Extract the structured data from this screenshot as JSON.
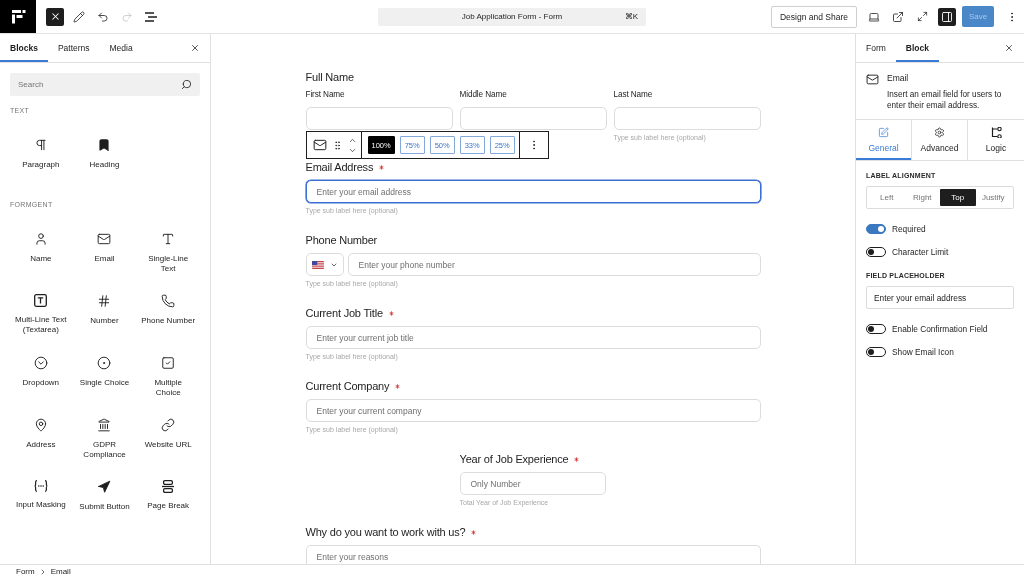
{
  "top_bar": {
    "inserter_button": {
      "selected": true
    },
    "redo_button": {
      "disabled": true
    },
    "command": {
      "title": "Job Application Form - Form",
      "shortcut": "⌘K"
    },
    "design_button": "Design and Share",
    "sidebar_toggle": {
      "selected": true
    },
    "save_button": {
      "label": "Save",
      "disabled": true
    }
  },
  "inserter": {
    "tabs": [
      {
        "label": "Blocks",
        "selected": true
      },
      {
        "label": "Patterns",
        "selected": false
      },
      {
        "label": "Media",
        "selected": false
      }
    ],
    "search": {
      "placeholder": "Search"
    },
    "groups": [
      {
        "title": "TEXT",
        "items": [
          {
            "kind": "paragraph",
            "label": "Paragraph"
          },
          {
            "kind": "heading",
            "label": "Heading"
          }
        ]
      },
      {
        "title": "FORMGENT",
        "items": [
          {
            "kind": "name",
            "label": "Name"
          },
          {
            "kind": "email",
            "label": "Email"
          },
          {
            "kind": "text",
            "label": "Single-Line\nText"
          },
          {
            "kind": "textarea",
            "label": "Multi-Line Text\n(Textarea)"
          },
          {
            "kind": "number",
            "label": "Number"
          },
          {
            "kind": "phone",
            "label": "Phone Number"
          },
          {
            "kind": "dropdown",
            "label": "Dropdown"
          },
          {
            "kind": "radio",
            "label": "Single Choice"
          },
          {
            "kind": "checkbox",
            "label": "Multiple\nChoice"
          },
          {
            "kind": "address",
            "label": "Address"
          },
          {
            "kind": "gdpr",
            "label": "GDPR\nCompliance"
          },
          {
            "kind": "url",
            "label": "Website URL"
          },
          {
            "kind": "mask",
            "label": "Input Masking"
          },
          {
            "kind": "submit",
            "label": "Submit Button"
          },
          {
            "kind": "pagebreak",
            "label": "Page Break"
          }
        ]
      }
    ]
  },
  "form": {
    "toolbar": {
      "width_options": [
        {
          "label": "100%",
          "selected": true
        },
        {
          "label": "75%",
          "selected": false
        },
        {
          "label": "50%",
          "selected": false
        },
        {
          "label": "33%",
          "selected": false
        },
        {
          "label": "25%",
          "selected": false
        }
      ]
    },
    "fields": [
      {
        "kind": "name",
        "label": "Full Name",
        "required": false,
        "selected": false,
        "subfields": [
          {
            "label": "First Name"
          },
          {
            "label": "Middle Name"
          },
          {
            "label": "Last Name",
            "sublabel": "Type sub label here (optional)"
          }
        ]
      },
      {
        "kind": "email",
        "label": "Email Address",
        "required": true,
        "selected": true,
        "placeholder": "Enter your email address",
        "sublabel": "Type sub label here (optional)"
      },
      {
        "kind": "phone",
        "label": "Phone Number",
        "required": false,
        "selected": false,
        "placeholder": "Enter your phone number",
        "sublabel": "Type sub label here (optional)"
      },
      {
        "kind": "text",
        "label": "Current Job Title",
        "required": true,
        "selected": false,
        "placeholder": "Enter your current job title",
        "sublabel": "Type sub label here (optional)"
      },
      {
        "kind": "text",
        "label": "Current Company",
        "required": true,
        "selected": false,
        "placeholder": "Enter your current company",
        "sublabel": "Type sub label here (optional)"
      },
      {
        "kind": "number",
        "label": "Year of Job Experience",
        "required": true,
        "selected": false,
        "placeholder": "Only Number",
        "sublabel": "Total Year of Job Experience"
      },
      {
        "kind": "textarea",
        "label": "Why do you want to work with us?",
        "required": true,
        "selected": false,
        "placeholder": "Enter your reasons"
      }
    ]
  },
  "settings": {
    "tabs": [
      {
        "label": "Form",
        "selected": false
      },
      {
        "label": "Block",
        "selected": true
      }
    ],
    "block": {
      "title": "Email",
      "description": "Insert an email field for users to enter their email address."
    },
    "sub_tabs": [
      {
        "kind": "general",
        "label": "General",
        "selected": true
      },
      {
        "kind": "advanced",
        "label": "Advanced",
        "selected": false
      },
      {
        "kind": "logic",
        "label": "Logic",
        "selected": false
      }
    ],
    "label_alignment": {
      "title": "LABEL ALIGNMENT",
      "options": [
        {
          "label": "Left",
          "selected": false
        },
        {
          "label": "Right",
          "selected": false
        },
        {
          "label": "Top",
          "selected": true
        },
        {
          "label": "Justify",
          "selected": false
        }
      ]
    },
    "controls": [
      {
        "kind": "toggle",
        "label": "Required",
        "on": true
      },
      {
        "kind": "toggle",
        "label": "Character Limit",
        "on": false
      },
      {
        "kind": "field",
        "title": "FIELD PLACEHOLDER",
        "value": "Enter your email address"
      },
      {
        "kind": "toggle",
        "label": "Enable Confirmation Field",
        "on": false
      },
      {
        "kind": "toggle",
        "label": "Show Email Icon",
        "on": false
      }
    ]
  },
  "breadcrumb": [
    "Form",
    "Email"
  ]
}
